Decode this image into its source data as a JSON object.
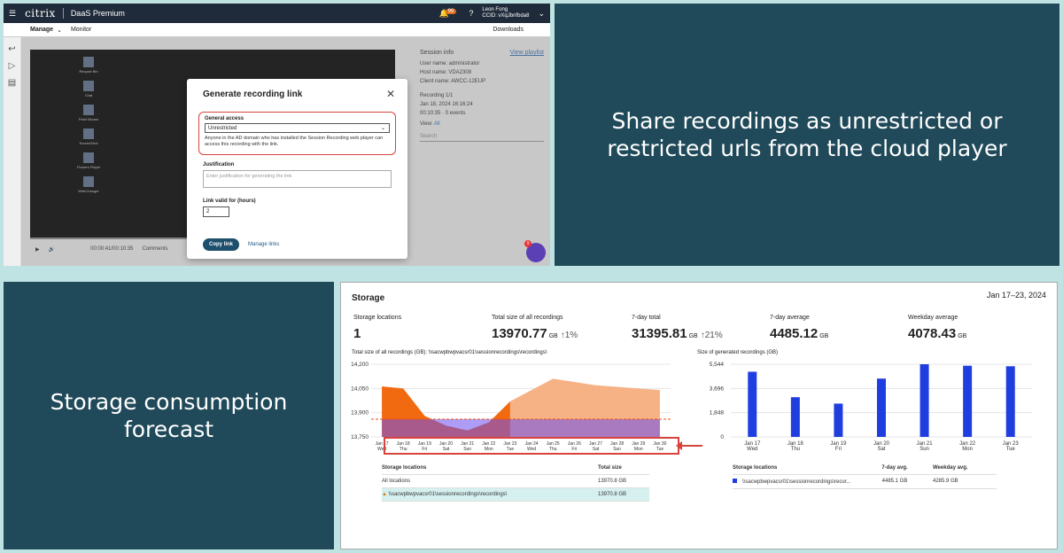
{
  "console": {
    "brand": "citrix",
    "product": "DaaS Premium",
    "notif_count": "99",
    "user_name": "Leon Fong",
    "user_sub": "CCID: vXqJbnfbda8",
    "nav_manage": "Manage",
    "nav_monitor": "Monitor",
    "nav_downloads": "Downloads",
    "desktop_icons": [
      "Recycle Bin",
      "Chat",
      "Paint Mouse",
      "ScreenShot",
      "Flowers Player",
      "WebChanger"
    ],
    "time": "00:00:41/00:10:35",
    "comments": "Comments",
    "search_taskbar": "Type here to search"
  },
  "session_info": {
    "title": "Session info",
    "view_playlist": "View playlist",
    "user": "User name: administrator",
    "host": "Host name: VDA2308",
    "client": "Client name: AWCC-12EUP",
    "recording": "Recording 1/1",
    "date": "Jan 18, 2024 16:16:24",
    "duration": "00:10:35 · 0 events",
    "view_label": "View:",
    "view_value": "All",
    "search": "Search"
  },
  "modal": {
    "title": "Generate recording link",
    "general_access": "General access",
    "access_value": "Unrestricted",
    "help": "Anyone in the AD domain who has installed the Session Recording web player can access this recording with the link.",
    "justification": "Justification",
    "justification_ph": "Enter justification for generating the link",
    "link_valid": "Link valid for (hours)",
    "hours": "2",
    "copy": "Copy link",
    "manage": "Manage links"
  },
  "captions": {
    "share": "Share recordings as unrestricted or restricted urls from the cloud player",
    "forecast": "Storage consumption forecast"
  },
  "storage": {
    "title": "Storage",
    "range": "Jan 17–23, 2024",
    "kpis": [
      {
        "label": "Storage locations",
        "value": "1",
        "unit": "",
        "change": ""
      },
      {
        "label": "Total size of all recordings",
        "value": "13970.77",
        "unit": "GB",
        "change": "↑1%"
      },
      {
        "label": "7-day total",
        "value": "31395.81",
        "unit": "GB",
        "change": "↑21%"
      },
      {
        "label": "7-day average",
        "value": "4485.12",
        "unit": "GB",
        "change": ""
      },
      {
        "label": "Weekday average",
        "value": "4078.43",
        "unit": "GB",
        "change": ""
      }
    ],
    "left_chart_title": "Total size of all recordings (GB): \\\\sacwpbwpvacsr01\\sessionrecordings\\recordings\\",
    "right_chart_title": "Size of generated recordings (GB)",
    "left_table": {
      "h1": "Storage locations",
      "h2": "Total size",
      "rows": [
        [
          "All locations",
          "13970.8 GB"
        ],
        [
          "\\\\sacwpbwpvacsr01\\sessionrecordings\\recordings\\",
          "13970.8 GB"
        ]
      ]
    },
    "right_table": {
      "h1": "Storage locations",
      "h2": "7-day avg.",
      "h3": "Weekday avg.",
      "rows": [
        [
          "\\\\sacwpbwpvacsr01\\sessionrecordings\\recor...",
          "4485.1 GB",
          "4285.9 GB"
        ]
      ]
    }
  },
  "chart_data": [
    {
      "type": "area",
      "title": "Total size of all recordings (GB): \\\\sacwpbwpvacsr01\\sessionrecordings\\recordings\\",
      "x": [
        "Jan 17\nWed",
        "Jan 18\nThu",
        "Jan 19\nFri",
        "Jan 20\nSat",
        "Jan 21\nSun",
        "Jan 22\nMon",
        "Jan 23\nTue",
        "Jan 24\nWed",
        "Jan 25\nThu",
        "Jan 26\nFri",
        "Jan 27\nSat",
        "Jan 28\nSun",
        "Jan 29\nMon",
        "Jan 30\nTue"
      ],
      "series": [
        {
          "values": [
            14063,
            14050,
            13880,
            13820,
            13790,
            13840,
            13970,
            null,
            null,
            null,
            null,
            null,
            null,
            null
          ],
          "color": "#f26a10"
        },
        {
          "values": [
            null,
            null,
            null,
            null,
            null,
            null,
            13970,
            14040,
            14110,
            14090,
            14070,
            14060,
            14050,
            14040
          ],
          "color": "#f6b184"
        }
      ],
      "baseline": 13750,
      "threshold": 13860,
      "threshold_color": "#e8521a",
      "ylim": [
        13750,
        14200
      ],
      "yticks": [
        "14,200",
        "14,050",
        "13,900",
        "13,750"
      ],
      "legend": "none"
    },
    {
      "type": "bar",
      "title": "Size of generated recordings (GB)",
      "categories": [
        "Jan 17\nWed",
        "Jan 18\nThu",
        "Jan 19\nFri",
        "Jan 20\nSat",
        "Jan 21\nSun",
        "Jan 22\nMon",
        "Jan 23\nTue"
      ],
      "values": [
        4970,
        3030,
        2540,
        4450,
        5544,
        5430,
        5390
      ],
      "color": "#1f3ee0",
      "ylim": [
        0,
        5544
      ],
      "yticks": [
        "5,544",
        "3,696",
        "1,848",
        "0"
      ],
      "legend": "none"
    }
  ]
}
